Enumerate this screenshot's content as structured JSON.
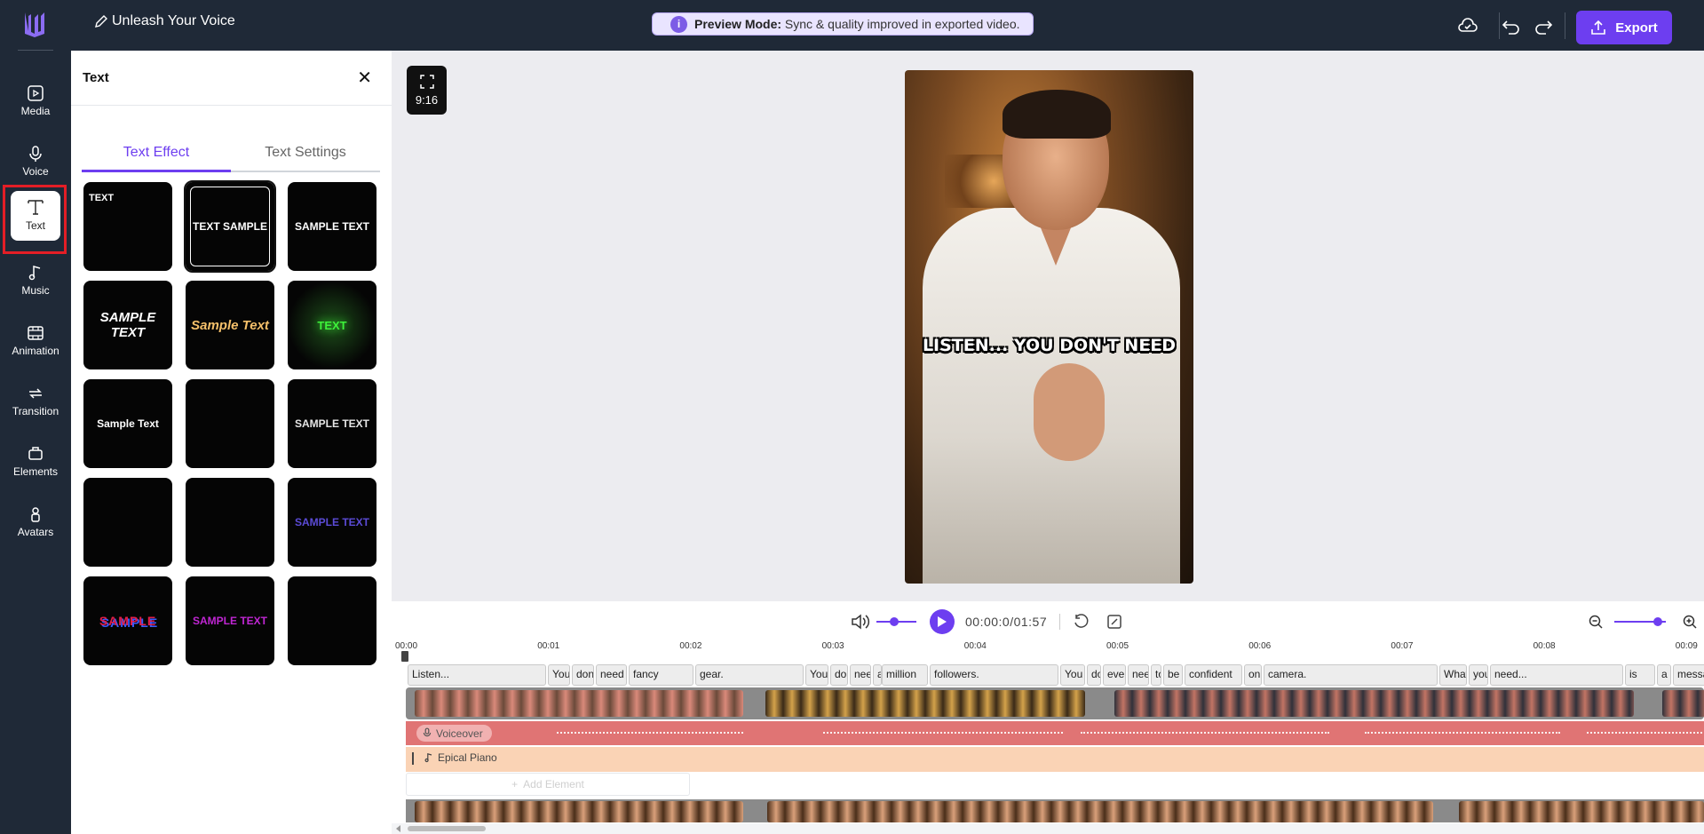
{
  "app": {
    "project_title": "Unleash Your Voice",
    "preview_banner": {
      "bold": "Preview Mode:",
      "text": "Sync & quality improved in exported video."
    },
    "export_label": "Export"
  },
  "sidebar": {
    "items": [
      {
        "label": "Media",
        "icon": "media-icon"
      },
      {
        "label": "Voice",
        "icon": "microphone-icon"
      },
      {
        "label": "Text",
        "icon": "text-icon",
        "active": true
      },
      {
        "label": "Music",
        "icon": "music-note-icon"
      },
      {
        "label": "Animation",
        "icon": "film-icon"
      },
      {
        "label": "Transition",
        "icon": "transition-icon"
      },
      {
        "label": "Elements",
        "icon": "elements-icon"
      },
      {
        "label": "Avatars",
        "icon": "avatar-icon"
      }
    ]
  },
  "panel": {
    "title": "Text",
    "tabs": [
      "Text Effect",
      "Text Settings"
    ],
    "active_tab": 0,
    "effects": [
      {
        "label": "TEXT",
        "color": "#ffffff"
      },
      {
        "label": "TEXT SAMPLE",
        "color": "#ffffff",
        "accent": "#f2a20c",
        "selected": true
      },
      {
        "label": "SAMPLE TEXT",
        "color": "#ffffff",
        "accent": "#e11d48"
      },
      {
        "label": "SAMPLE TEXT",
        "color": "#ffffff",
        "accent": "#d8f23a"
      },
      {
        "label": "Sample Text",
        "color": "#f5c06a"
      },
      {
        "label": "TEXT",
        "color": "#3df23a"
      },
      {
        "label": "Sample Text",
        "color": "#ffffff"
      },
      {
        "label": "",
        "color": "#ffffff"
      },
      {
        "label": "SAMPLE TEXT",
        "color": "#e5e5e5"
      },
      {
        "label": "",
        "color": "#ffffff"
      },
      {
        "label": "",
        "color": "#ffffff"
      },
      {
        "label": "SAMPLE TEXT",
        "color": "#5b4bd6"
      },
      {
        "label": "SAMPLE",
        "color": "#e11d48",
        "accent": "#3b5bff"
      },
      {
        "label": "SAMPLE TEXT",
        "color": "#c026d3"
      },
      {
        "label": "",
        "color": "#ffffff"
      }
    ]
  },
  "canvas": {
    "aspect_ratio": "9:16",
    "caption": "LISTEN... YOU DON'T NEED"
  },
  "timeline": {
    "time_display": "00:00:0/01:57",
    "ruler": [
      "00:00",
      "00:01",
      "00:02",
      "00:03",
      "00:04",
      "00:05",
      "00:06",
      "00:07",
      "00:08",
      "00:09"
    ],
    "words": [
      "Listen...",
      "You",
      "don",
      "need",
      "fancy",
      "gear.",
      "You",
      "don",
      "nee",
      "a",
      "million",
      "followers.",
      "You",
      "don",
      "eve",
      "nee",
      "to",
      "be",
      "confident",
      "on",
      "camera.",
      "What",
      "you",
      "need...",
      "is",
      "a",
      "message"
    ],
    "voice_label": "Voiceover",
    "music_label": "Epical Piano",
    "add_element_label": "Add Element",
    "volume_level": 0.45,
    "zoom_level": 0.85
  }
}
